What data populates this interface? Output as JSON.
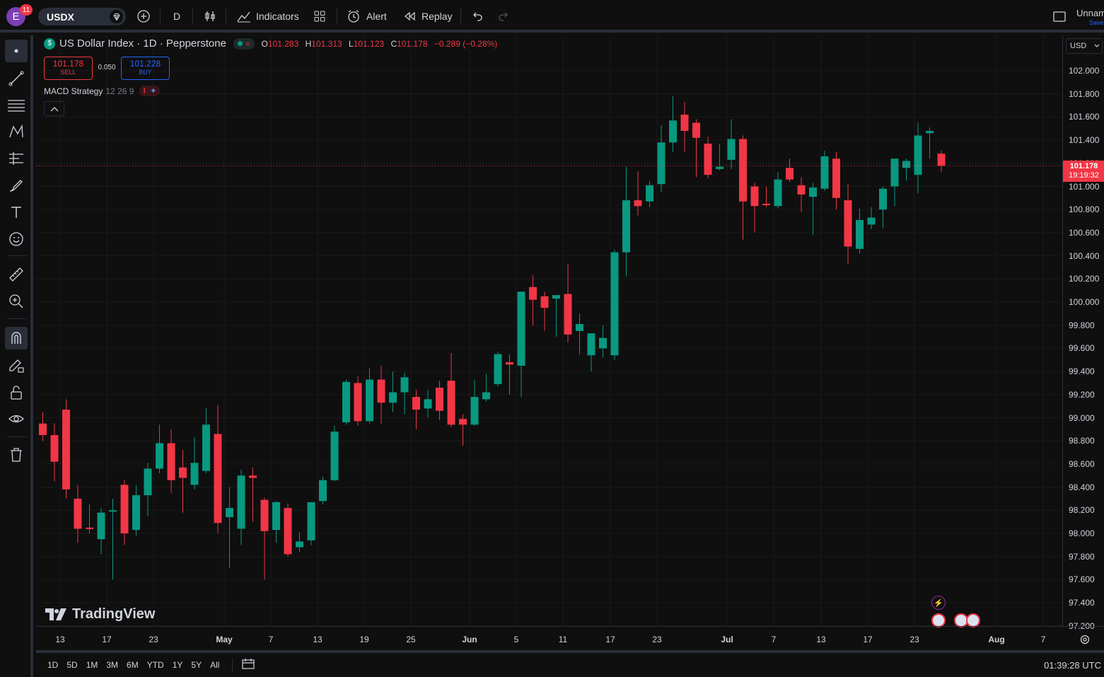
{
  "topbar": {
    "avatar_letter": "E",
    "notifications": "11",
    "symbol": "USDX",
    "interval": "D",
    "indicators_label": "Indicators",
    "alert_label": "Alert",
    "replay_label": "Replay",
    "layout_name": "Unnamed",
    "save_label": "Save"
  },
  "legend": {
    "title": "US Dollar Index · 1D · Pepperstone",
    "o_label": "O",
    "o": "101.283",
    "h_label": "H",
    "h": "101.313",
    "l_label": "L",
    "l": "101.123",
    "c_label": "C",
    "c": "101.178",
    "change": "−0.289 (−0.28%)",
    "sell_price": "101.178",
    "sell_label": "SELL",
    "buy_price": "101.228",
    "buy_label": "BUY",
    "spread": "0.050",
    "study_name": "MACD Strategy",
    "study_params": "12 26 9"
  },
  "price_scale": {
    "currency": "USD",
    "labels": [
      "102.000",
      "101.800",
      "101.600",
      "101.400",
      "101.200",
      "101.000",
      "100.800",
      "100.600",
      "100.400",
      "100.200",
      "100.000",
      "99.800",
      "99.600",
      "99.400",
      "99.200",
      "99.000",
      "98.800",
      "98.600",
      "98.400",
      "98.200",
      "98.000",
      "97.800",
      "97.600",
      "97.400",
      "97.200"
    ],
    "last_price": "101.178",
    "countdown": "19:19:32"
  },
  "time_scale": {
    "labels": [
      "13",
      "17",
      "23",
      "May",
      "7",
      "13",
      "19",
      "25",
      "Jun",
      "5",
      "11",
      "17",
      "23",
      "Jul",
      "7",
      "13",
      "17",
      "23",
      "Aug",
      "7"
    ]
  },
  "bottombar": {
    "ranges": [
      "1D",
      "5D",
      "1M",
      "3M",
      "6M",
      "YTD",
      "1Y",
      "5Y",
      "All"
    ],
    "clock": "01:39:28 UTC"
  },
  "watermark": "TradingView",
  "colors": {
    "up": "#089981",
    "down": "#f23645",
    "bg": "#0f0f0f",
    "grid": "#1a1a1a",
    "accent": "#2962ff"
  },
  "chart_data": {
    "type": "candlestick",
    "ylim": [
      97.1,
      102.2
    ],
    "candles": [
      {
        "o": 98.95,
        "h": 99.05,
        "l": 98.8,
        "c": 98.85
      },
      {
        "o": 98.85,
        "h": 98.95,
        "l": 98.45,
        "c": 98.62
      },
      {
        "o": 99.07,
        "h": 99.16,
        "l": 98.3,
        "c": 98.38
      },
      {
        "o": 98.3,
        "h": 98.42,
        "l": 97.92,
        "c": 98.04
      },
      {
        "o": 98.05,
        "h": 98.25,
        "l": 98.0,
        "c": 98.04
      },
      {
        "o": 97.95,
        "h": 98.22,
        "l": 97.82,
        "c": 98.18
      },
      {
        "o": 98.2,
        "h": 98.3,
        "l": 97.6,
        "c": 98.2
      },
      {
        "o": 98.42,
        "h": 98.46,
        "l": 97.9,
        "c": 98.0
      },
      {
        "o": 98.03,
        "h": 98.42,
        "l": 97.98,
        "c": 98.33
      },
      {
        "o": 98.33,
        "h": 98.61,
        "l": 98.15,
        "c": 98.56
      },
      {
        "o": 98.56,
        "h": 98.94,
        "l": 98.52,
        "c": 98.78
      },
      {
        "o": 98.78,
        "h": 98.9,
        "l": 98.35,
        "c": 98.46
      },
      {
        "o": 98.57,
        "h": 98.72,
        "l": 98.18,
        "c": 98.48
      },
      {
        "o": 98.42,
        "h": 98.83,
        "l": 98.38,
        "c": 98.61
      },
      {
        "o": 98.54,
        "h": 99.08,
        "l": 98.52,
        "c": 98.94
      },
      {
        "o": 98.86,
        "h": 99.11,
        "l": 98.0,
        "c": 98.09
      },
      {
        "o": 98.14,
        "h": 98.4,
        "l": 97.7,
        "c": 98.22
      },
      {
        "o": 98.04,
        "h": 98.55,
        "l": 97.9,
        "c": 98.5
      },
      {
        "o": 98.5,
        "h": 98.57,
        "l": 98.1,
        "c": 98.48
      },
      {
        "o": 98.29,
        "h": 98.31,
        "l": 97.6,
        "c": 98.02
      },
      {
        "o": 98.03,
        "h": 98.28,
        "l": 97.92,
        "c": 98.27
      },
      {
        "o": 98.22,
        "h": 98.26,
        "l": 97.8,
        "c": 97.82
      },
      {
        "o": 97.88,
        "h": 98.01,
        "l": 97.84,
        "c": 97.93
      },
      {
        "o": 97.94,
        "h": 98.27,
        "l": 97.9,
        "c": 98.27
      },
      {
        "o": 98.28,
        "h": 98.49,
        "l": 98.25,
        "c": 98.46
      },
      {
        "o": 98.46,
        "h": 98.93,
        "l": 98.45,
        "c": 98.88
      },
      {
        "o": 98.96,
        "h": 99.33,
        "l": 98.94,
        "c": 99.31
      },
      {
        "o": 99.3,
        "h": 99.36,
        "l": 98.93,
        "c": 98.97
      },
      {
        "o": 98.97,
        "h": 99.43,
        "l": 98.95,
        "c": 99.33
      },
      {
        "o": 99.33,
        "h": 99.45,
        "l": 98.95,
        "c": 99.13
      },
      {
        "o": 99.13,
        "h": 99.4,
        "l": 99.05,
        "c": 99.22
      },
      {
        "o": 99.22,
        "h": 99.39,
        "l": 99.03,
        "c": 99.35
      },
      {
        "o": 99.18,
        "h": 99.24,
        "l": 98.9,
        "c": 99.07
      },
      {
        "o": 99.08,
        "h": 99.24,
        "l": 99.0,
        "c": 99.16
      },
      {
        "o": 99.26,
        "h": 99.32,
        "l": 98.98,
        "c": 99.06
      },
      {
        "o": 99.32,
        "h": 99.56,
        "l": 98.92,
        "c": 98.94
      },
      {
        "o": 98.99,
        "h": 99.03,
        "l": 98.76,
        "c": 98.94
      },
      {
        "o": 98.94,
        "h": 99.33,
        "l": 98.93,
        "c": 99.18
      },
      {
        "o": 99.16,
        "h": 99.38,
        "l": 99.14,
        "c": 99.22
      },
      {
        "o": 99.29,
        "h": 99.57,
        "l": 99.27,
        "c": 99.55
      },
      {
        "o": 99.48,
        "h": 99.55,
        "l": 99.2,
        "c": 99.46
      },
      {
        "o": 99.45,
        "h": 100.09,
        "l": 99.18,
        "c": 100.09
      },
      {
        "o": 100.13,
        "h": 100.23,
        "l": 99.8,
        "c": 100.02
      },
      {
        "o": 100.05,
        "h": 100.09,
        "l": 99.75,
        "c": 99.95
      },
      {
        "o": 100.03,
        "h": 100.06,
        "l": 99.7,
        "c": 100.06
      },
      {
        "o": 100.07,
        "h": 100.33,
        "l": 99.65,
        "c": 99.72
      },
      {
        "o": 99.75,
        "h": 99.9,
        "l": 99.55,
        "c": 99.81
      },
      {
        "o": 99.54,
        "h": 99.72,
        "l": 99.4,
        "c": 99.73
      },
      {
        "o": 99.6,
        "h": 99.8,
        "l": 99.52,
        "c": 99.69
      },
      {
        "o": 99.54,
        "h": 100.45,
        "l": 99.5,
        "c": 100.43
      },
      {
        "o": 100.43,
        "h": 101.17,
        "l": 100.22,
        "c": 100.88
      },
      {
        "o": 100.88,
        "h": 101.13,
        "l": 100.75,
        "c": 100.83
      },
      {
        "o": 100.87,
        "h": 101.05,
        "l": 100.82,
        "c": 101.01
      },
      {
        "o": 101.02,
        "h": 101.53,
        "l": 100.95,
        "c": 101.38
      },
      {
        "o": 101.38,
        "h": 101.78,
        "l": 101.3,
        "c": 101.57
      },
      {
        "o": 101.62,
        "h": 101.73,
        "l": 101.3,
        "c": 101.48
      },
      {
        "o": 101.55,
        "h": 101.58,
        "l": 101.08,
        "c": 101.42
      },
      {
        "o": 101.37,
        "h": 101.43,
        "l": 101.07,
        "c": 101.1
      },
      {
        "o": 101.15,
        "h": 101.37,
        "l": 101.14,
        "c": 101.17
      },
      {
        "o": 101.23,
        "h": 101.58,
        "l": 101.15,
        "c": 101.41
      },
      {
        "o": 101.41,
        "h": 101.44,
        "l": 100.54,
        "c": 100.87
      },
      {
        "o": 101.0,
        "h": 101.03,
        "l": 100.6,
        "c": 100.83
      },
      {
        "o": 100.85,
        "h": 101.0,
        "l": 100.82,
        "c": 100.84
      },
      {
        "o": 100.83,
        "h": 101.12,
        "l": 100.81,
        "c": 101.06
      },
      {
        "o": 101.16,
        "h": 101.24,
        "l": 101.04,
        "c": 101.06
      },
      {
        "o": 101.01,
        "h": 101.08,
        "l": 100.78,
        "c": 100.93
      },
      {
        "o": 100.91,
        "h": 101.03,
        "l": 100.58,
        "c": 100.99
      },
      {
        "o": 100.98,
        "h": 101.31,
        "l": 100.96,
        "c": 101.26
      },
      {
        "o": 101.24,
        "h": 101.3,
        "l": 100.8,
        "c": 100.9
      },
      {
        "o": 100.88,
        "h": 101.02,
        "l": 100.33,
        "c": 100.48
      },
      {
        "o": 100.46,
        "h": 100.81,
        "l": 100.42,
        "c": 100.71
      },
      {
        "o": 100.67,
        "h": 100.82,
        "l": 100.63,
        "c": 100.73
      },
      {
        "o": 100.8,
        "h": 101.0,
        "l": 100.64,
        "c": 100.98
      },
      {
        "o": 101.0,
        "h": 101.23,
        "l": 100.83,
        "c": 101.24
      },
      {
        "o": 101.16,
        "h": 101.24,
        "l": 101.05,
        "c": 101.22
      },
      {
        "o": 101.1,
        "h": 101.55,
        "l": 100.94,
        "c": 101.44
      },
      {
        "o": 101.46,
        "h": 101.51,
        "l": 101.24,
        "c": 101.48
      },
      {
        "o": 101.283,
        "h": 101.313,
        "l": 101.123,
        "c": 101.178
      }
    ]
  }
}
